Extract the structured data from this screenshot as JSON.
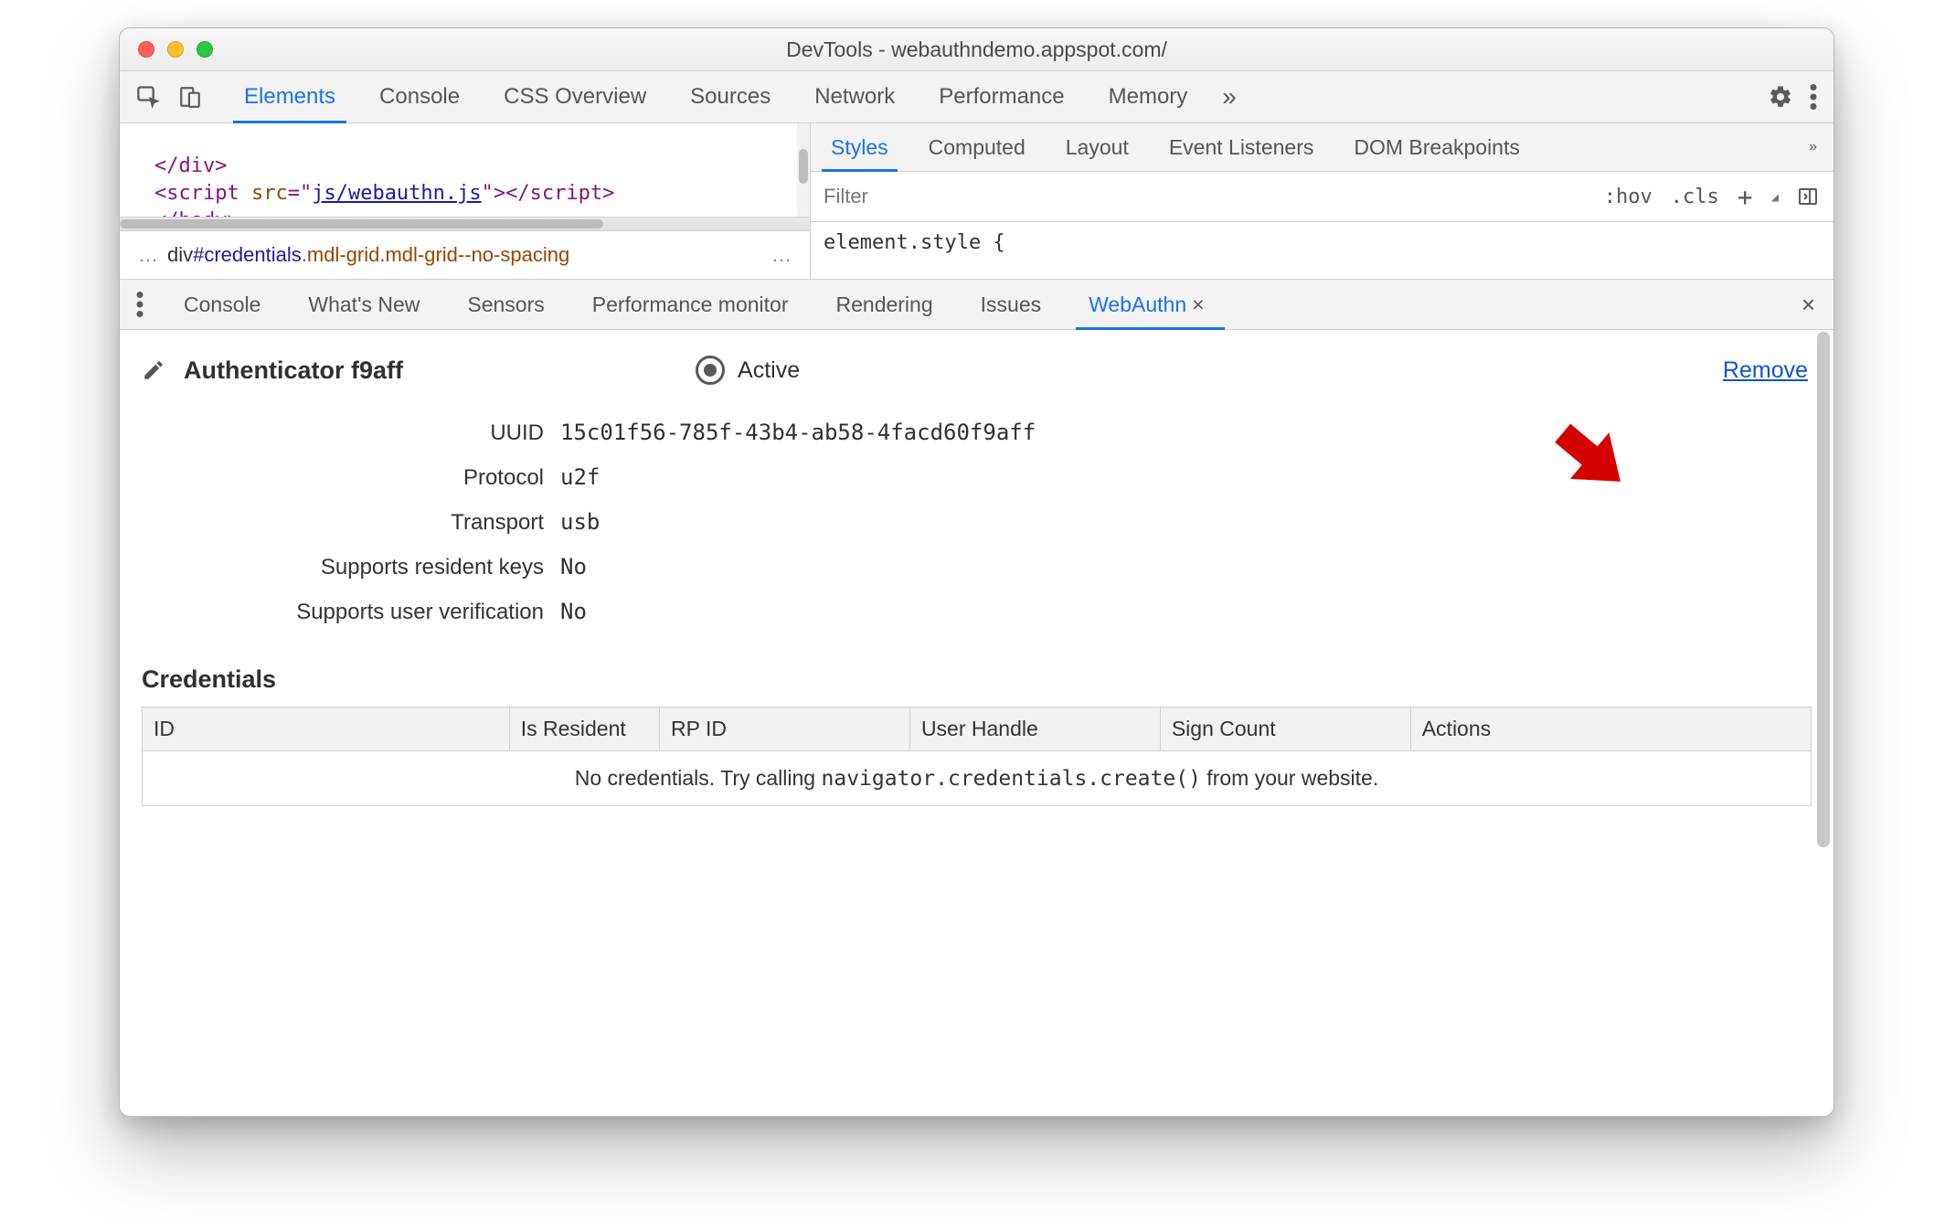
{
  "titlebar": {
    "title": "DevTools - webauthndemo.appspot.com/"
  },
  "main_tabs": {
    "items": [
      "Elements",
      "Console",
      "CSS Overview",
      "Sources",
      "Network",
      "Performance",
      "Memory"
    ],
    "active_index": 0,
    "overflow_glyph": "»"
  },
  "elements_pane": {
    "code_line1_open": "</div>",
    "code_line2_a": "<script ",
    "code_line2_attr": "src",
    "code_line2_eq": "=\"",
    "code_line2_src": "js/webauthn.js",
    "code_line2_b": "\"></script>",
    "code_line3": "</body>",
    "crumb_tag": "div",
    "crumb_id": "#credentials",
    "crumb_classes": ".mdl-grid.mdl-grid--no-spacing",
    "ellipsis": "…"
  },
  "styles_pane": {
    "tabs": [
      "Styles",
      "Computed",
      "Layout",
      "Event Listeners",
      "DOM Breakpoints"
    ],
    "active_index": 0,
    "overflow_glyph": "»",
    "filter_placeholder": "Filter",
    "actions": {
      "hov": ":hov",
      "cls": ".cls",
      "plus": "+"
    },
    "body_text": "element.style {"
  },
  "drawer": {
    "tabs": [
      "Console",
      "What's New",
      "Sensors",
      "Performance monitor",
      "Rendering",
      "Issues",
      "WebAuthn"
    ],
    "active_index": 6,
    "close_glyph": "×"
  },
  "authenticator": {
    "title": "Authenticator f9aff",
    "active_label": "Active",
    "remove_label": "Remove",
    "props": [
      {
        "label": "UUID",
        "value": "15c01f56-785f-43b4-ab58-4facd60f9aff"
      },
      {
        "label": "Protocol",
        "value": "u2f"
      },
      {
        "label": "Transport",
        "value": "usb"
      },
      {
        "label": "Supports resident keys",
        "value": "No"
      },
      {
        "label": "Supports user verification",
        "value": "No"
      }
    ]
  },
  "credentials": {
    "heading": "Credentials",
    "columns": [
      "ID",
      "Is Resident",
      "RP ID",
      "User Handle",
      "Sign Count",
      "Actions"
    ],
    "empty_prefix": "No credentials. Try calling ",
    "empty_code": "navigator.credentials.create()",
    "empty_suffix": " from your website."
  }
}
